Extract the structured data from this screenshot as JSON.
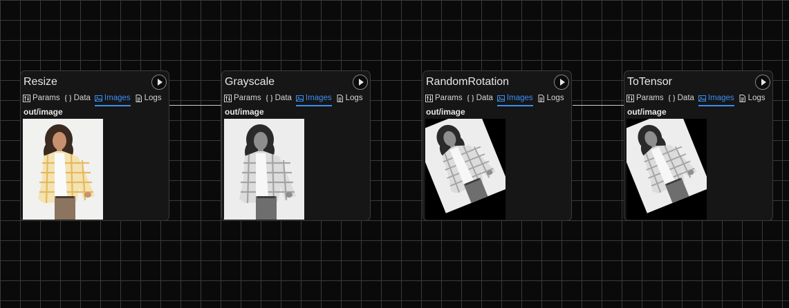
{
  "nodes": [
    {
      "title": "Resize",
      "tabs": [
        "Params",
        "Data",
        "Images",
        "Logs"
      ],
      "active_tab": "Images",
      "output_label": "out/image",
      "image_style": "color"
    },
    {
      "title": "Grayscale",
      "tabs": [
        "Params",
        "Data",
        "Images",
        "Logs"
      ],
      "active_tab": "Images",
      "output_label": "out/image",
      "image_style": "grayscale"
    },
    {
      "title": "RandomRotation",
      "tabs": [
        "Params",
        "Data",
        "Images",
        "Logs"
      ],
      "active_tab": "Images",
      "output_label": "out/image",
      "image_style": "grayscale-rotated"
    },
    {
      "title": "ToTensor",
      "tabs": [
        "Params",
        "Data",
        "Images",
        "Logs"
      ],
      "active_tab": "Images",
      "output_label": "out/image",
      "image_style": "grayscale-rotated"
    }
  ],
  "icons": {
    "run": "play-icon",
    "tabs": [
      "sliders-icon",
      "braces-icon",
      "image-icon",
      "document-icon"
    ]
  },
  "colors": {
    "accent": "#3b8ef0",
    "background": "#0a0a0a",
    "node": "#161616"
  }
}
